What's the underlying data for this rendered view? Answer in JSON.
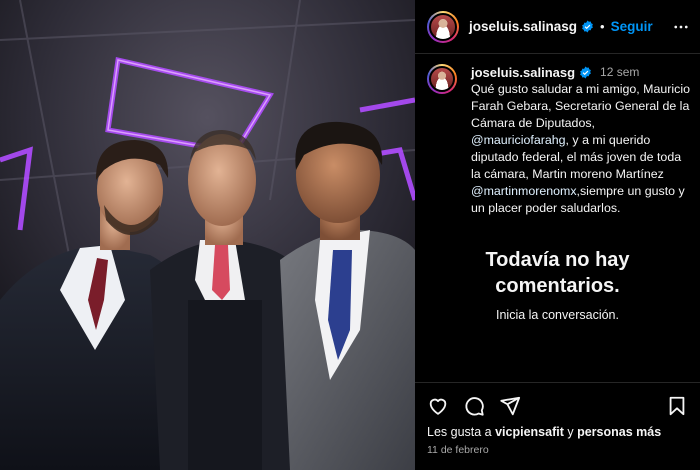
{
  "post": {
    "username": "joseluis.salinasg",
    "follow_label": "Seguir",
    "separator": "•"
  },
  "caption": {
    "username": "joseluis.salinasg",
    "time": "12 sem",
    "text_1": "Qué gusto saludar a mi amigo, Mauricio Farah Gebara, Secretario General de la Cámara de Diputados, ",
    "mention_1": "@mauriciofarahg",
    "text_2": ", y a mi querido diputado federal, el más joven de toda la cámara, Martin moreno Martínez ",
    "mention_2": "@martinmorenomx",
    "text_3": ",siempre un gusto y un placer poder saludarlos."
  },
  "comments": {
    "empty_title": "Todavía no hay comentarios.",
    "empty_subtitle": "Inicia la conversación."
  },
  "likes": {
    "prefix": "Les gusta a ",
    "user": "vicpiensafit",
    "middle": " y ",
    "others": "personas más"
  },
  "date": "11 de febrero",
  "icons": {
    "like": "heart-icon",
    "comment": "comment-icon",
    "share": "share-icon",
    "save": "bookmark-icon",
    "more": "more-icon",
    "verified": "verified-badge-icon"
  },
  "colors": {
    "accent": "#0095f6",
    "background": "#000000",
    "secondary_text": "#a8a8a8",
    "mention": "#e0f1ff"
  }
}
